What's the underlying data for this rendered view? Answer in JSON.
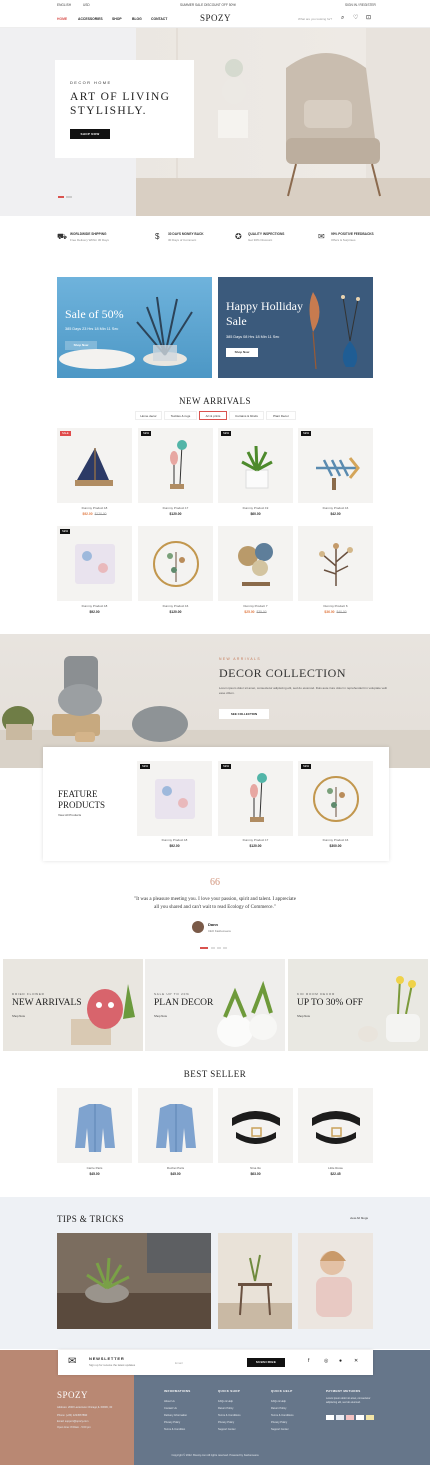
{
  "topbar": {
    "language": "ENGLISH",
    "currency": "USD",
    "promo": "SUMMER SALE DISCOUNT OFF 50%!",
    "account": "SIGN IN / REGISTER"
  },
  "nav": {
    "items": [
      "HOME",
      "ACCESSORIES",
      "SHOP",
      "BLOG",
      "CONTACT"
    ],
    "active": "HOME",
    "logo": "SPOZY",
    "search_placeholder": "What are you looking for?",
    "cart_count": "0",
    "wish_count": "0"
  },
  "hero": {
    "kicker": "DECOR HOME",
    "title_line1": "ART OF LIVING",
    "title_line2": "STYLISHLY.",
    "button": "SHOP NOW"
  },
  "features": [
    {
      "title": "WORLDWIDE SHIPPING",
      "text": "Free Delivery Within 30 Days"
    },
    {
      "title": "30 DAYS MONEY BACK",
      "text": "30 Days of Comment"
    },
    {
      "title": "QUALITY INSPECTIONS",
      "text": "Get 30% Discount"
    },
    {
      "title": "99% POSITIVE FEEDBACKS",
      "text": "Offers & Surprises"
    }
  ],
  "banners": [
    {
      "title": "Sale of 50%",
      "countdown": "385 Days  23 Hrs  18 Min  11 Sec",
      "button": "Shop Now",
      "color": "#5fa8d3"
    },
    {
      "title_line1": "Happy Holliday",
      "title_line2": "Sale",
      "countdown": "385 Days  08 Hrs  18 Min  11 Sec",
      "button": "Shop Now",
      "color": "#3c5a7c"
    }
  ],
  "new_arrivals": {
    "title": "NEW ARRIVALS",
    "tabs": [
      "Home decor",
      "Textiles & rugs",
      "Art & prints",
      "Curtains & blinds",
      "Plant Decor"
    ],
    "active_tab": "Art & prints",
    "products": [
      {
        "badge": "SALE",
        "name": "Dummy Product 18",
        "price": "$92.00",
        "old": "$120.00"
      },
      {
        "badge": "NEW",
        "name": "Dummy Product 17",
        "price": "$120.00",
        "old": ""
      },
      {
        "badge": "NEW",
        "name": "Dummy Product 19",
        "price": "$60.00",
        "old": ""
      },
      {
        "badge": "NEW",
        "name": "Dummy Product 16",
        "price": "$42.00",
        "old": ""
      },
      {
        "badge": "NEW",
        "name": "Dummy Product 18",
        "price": "$92.00",
        "old": ""
      },
      {
        "badge": "",
        "name": "Dummy Product 16",
        "price": "$120.00",
        "old": ""
      },
      {
        "badge": "",
        "name": "Dummy Product 7",
        "price": "$25.00",
        "old": "$35.00"
      },
      {
        "badge": "",
        "name": "Dummy Product 6",
        "price": "$36.00",
        "old": "$40.00"
      }
    ]
  },
  "decor": {
    "kicker": "NEW ARRIVALS",
    "title": "DECOR COLLECTION",
    "text": "Lorem ipsum dolor sit amet, consectetur adipiscing elit, sed do eiusmod. Duis aute irure dolor in reprehenderit in voluptate velit esse cillum.",
    "button": "SEE COLLECTION"
  },
  "feature_products": {
    "title_line1": "FEATURE",
    "title_line2": "PRODUCTS",
    "link": "View All Products",
    "products": [
      {
        "badge": "NEW",
        "name": "Dummy Product 18",
        "price": "$92.00"
      },
      {
        "badge": "NEW",
        "name": "Dummy Product 17",
        "price": "$120.00"
      },
      {
        "badge": "NEW",
        "name": "Dummy Product 16",
        "price": "$300.00"
      }
    ]
  },
  "testimonial": {
    "quote_mark": "66",
    "line1": "\"It was a pleasure meeting you. I love your passion, spirit and talent. I appreciate",
    "line2": "all you shared and can't wait to read Ecology of Commerce.\"",
    "name": "Dann",
    "role": "CEO Kashemeera"
  },
  "tiles": [
    {
      "kicker": "DRIED FLOWER",
      "title": "NEW ARRIVALS",
      "link": "Shop Now"
    },
    {
      "kicker": "SALE UP TO 20%",
      "title": "PLAN DECOR",
      "link": "Shop Now"
    },
    {
      "kicker": "KID ROOM DECOR",
      "title": "UP TO 30% OFF",
      "link": "Shop Now"
    }
  ],
  "best_seller": {
    "title": "BEST SELLER",
    "products": [
      {
        "name": "Carrie Paris",
        "price": "$45.00"
      },
      {
        "name": "Rochet Paris",
        "price": "$45.00"
      },
      {
        "name": "Nina Ilio",
        "price": "$63.00"
      },
      {
        "name": "Little Rosie",
        "price": "$22.45"
      }
    ]
  },
  "tips": {
    "title": "TIPS & TRICKS",
    "link": "view All blogs"
  },
  "newsletter": {
    "title": "NEWSLETTER",
    "text": "Sign up for receive the latest updates",
    "placeholder": "Email",
    "button": "SUBSCRIBE"
  },
  "footer": {
    "logo": "SPOZY",
    "address": "Address: 2048 Lanterneto Chicago,IL 60606, 30",
    "phone": "Phone: (+84) 1234567890",
    "email": "Email: support@spozy.com",
    "hours": "Open time: 8:00am - 5:00 pm",
    "columns": [
      {
        "title": "INFORMATIONS",
        "links": [
          "About Us",
          "Contact Us",
          "Delivery Information",
          "Privacy Policy",
          "Terms & Condition"
        ]
      },
      {
        "title": "QUICK SHOP",
        "links": [
          "FAQs & Help",
          "Return Policy",
          "Terms & Conditions",
          "Privacy Policy",
          "Support Center"
        ]
      },
      {
        "title": "QUICK HELP",
        "links": [
          "FAQs & Help",
          "Return Policy",
          "Terms & Conditions",
          "Privacy Policy",
          "Support Center"
        ]
      }
    ],
    "payment_title": "PAYMENT METHODS",
    "payment_text": "Lorem ipsum dolor sit amet, consectetur adipiscing elit, sed do eiusmod.",
    "copyright": "Copyright © 2022. Bounty.com All rights reserved. Powered by Kashemeera"
  }
}
